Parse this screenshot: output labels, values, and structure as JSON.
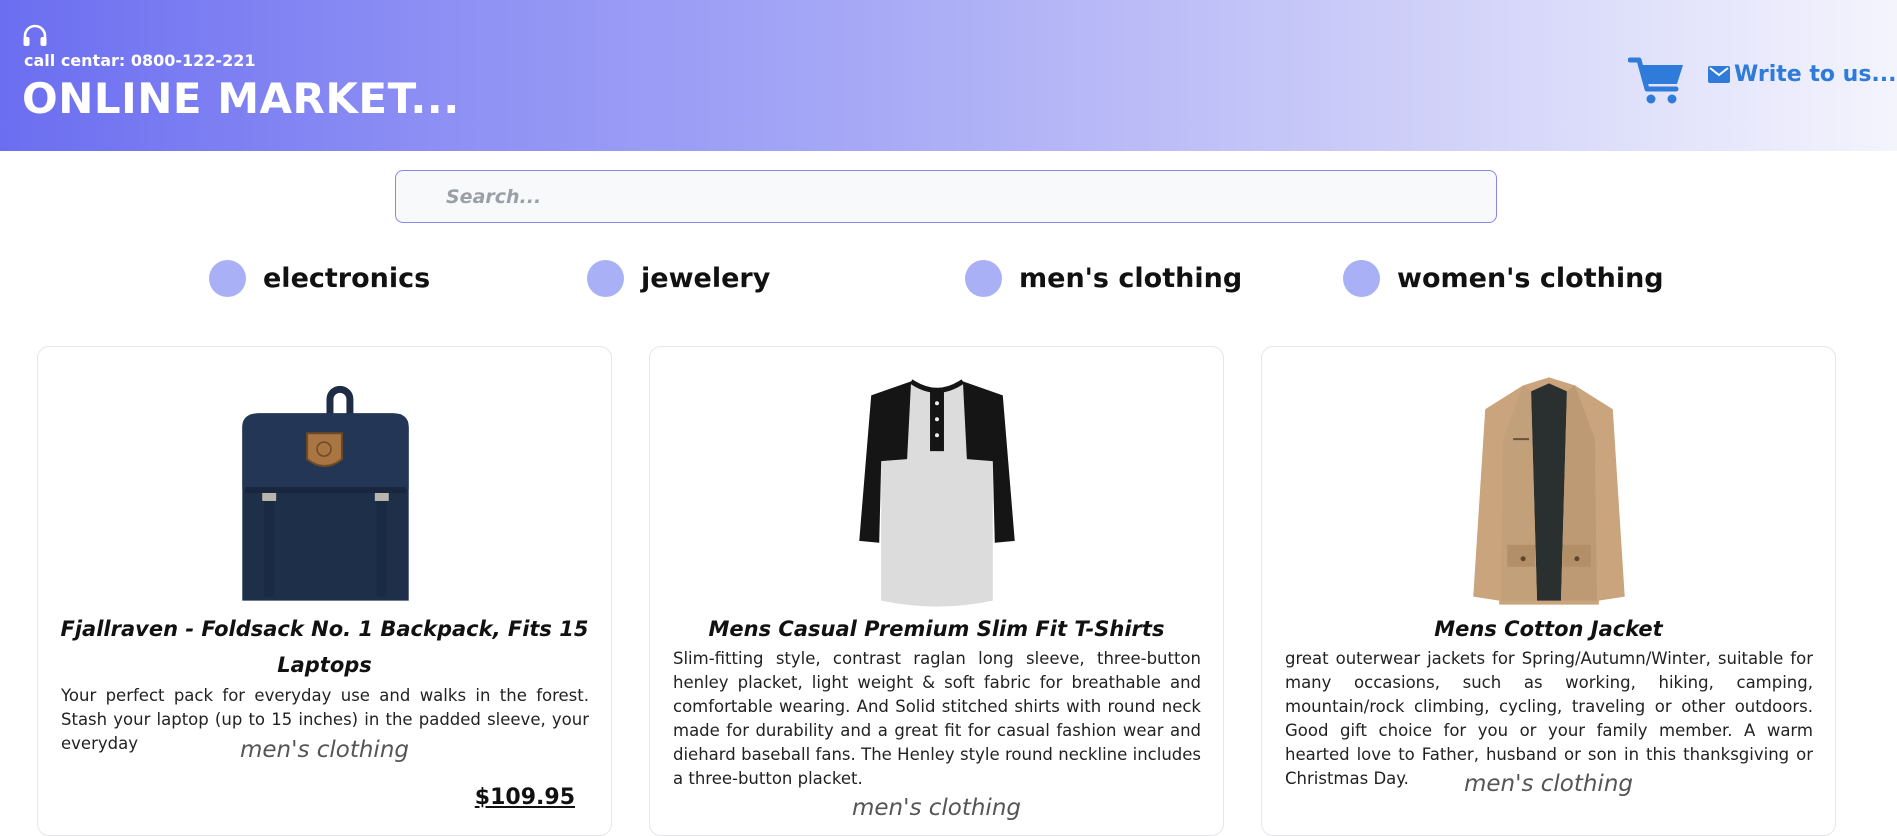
{
  "header": {
    "call_center": "call centar: 0800-122-221",
    "brand": "ONLINE MARKET...",
    "write_label": "Write to us...",
    "accent_color": "#2f7bd9"
  },
  "search": {
    "placeholder": "Search...",
    "value": ""
  },
  "categories": [
    {
      "label": "electronics"
    },
    {
      "label": "jewelery"
    },
    {
      "label": "men's clothing"
    },
    {
      "label": "women's clothing"
    }
  ],
  "products": [
    {
      "title": "Fjallraven - Foldsack No. 1 Backpack, Fits 15 Laptops",
      "description": "Your perfect pack for everyday use and walks in the forest. Stash your laptop (up to 15 inches) in the padded sleeve, your everyday",
      "category": "men's clothing",
      "price": "$109.95",
      "image_icon": "backpack-icon"
    },
    {
      "title": "Mens Casual Premium Slim Fit T-Shirts",
      "description": "Slim-fitting style, contrast raglan long sleeve, three-button henley placket, light weight & soft fabric for breathable and comfortable wearing. And Solid stitched shirts with round neck made for durability and a great fit for casual fashion wear and diehard baseball fans. The Henley style round neckline includes a three-button placket.",
      "category": "men's clothing",
      "image_icon": "tshirt-icon"
    },
    {
      "title": "Mens Cotton Jacket",
      "description": "great outerwear jackets for Spring/Autumn/Winter, suitable for many occasions, such as working, hiking, camping, mountain/rock climbing, cycling, traveling or other outdoors. Good gift choice for you or your family member. A warm hearted love to Father, husband or son in this thanksgiving or Christmas Day.",
      "category": "men's clothing",
      "image_icon": "jacket-icon"
    }
  ]
}
